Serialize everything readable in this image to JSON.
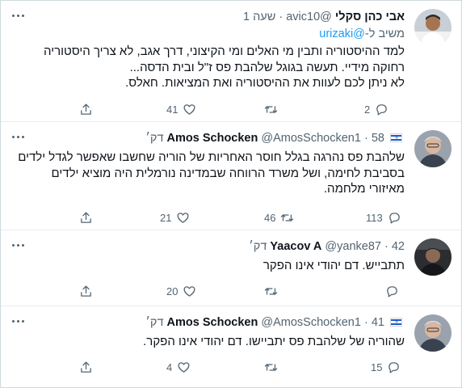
{
  "tweets": [
    {
      "name": "אבי כהן סקלי",
      "handle": "@avic10",
      "time": "שעה 1",
      "reply_prefix": "משיב ל-",
      "reply_user": "@urizaki",
      "text": "למד ההיסטוריה ותבין מי האלים ומי הקיצוני, דרך אגב, לא צריך היסטוריה רחוקה מידיי. תעשה בגוגל שלהבת פס ז\"ל ובית הדסה...\nלא ניתן לכם לעוות את ההיסטוריה ואת המציאות. חאלס.",
      "replies": "2",
      "retweets": "",
      "likes": "41",
      "avatar": "profile-photo-white-shirt"
    },
    {
      "name": "Amos Schocken",
      "handle": "@AmosSchocken1",
      "time": "58 דק׳",
      "text": "שלהבת פס נהרגה בגלל חוסר האחריות של הוריה שחשבו שאפשר לגדל ילדים בסביבת לחימה, ושל משרד הרווחה שבמדינה נורמלית היה מוציא ילדים מאיזורי מלחמה.",
      "replies": "113",
      "retweets": "46",
      "likes": "21",
      "avatar": "profile-photo-grey-hair"
    },
    {
      "name": "Yaacov A",
      "handle": "@yanke87",
      "time": "42 דק׳",
      "text": "תתבייש. דם יהודי אינו הפקר",
      "replies": "",
      "retweets": "",
      "likes": "20",
      "avatar": "profile-photo-dark"
    },
    {
      "name": "Amos Schocken",
      "handle": "@AmosSchocken1",
      "time": "41 דק׳",
      "text": "שהוריה של שלהבת פס יתביישו. דם יהודי אינו הפקר.",
      "replies": "15",
      "retweets": "",
      "likes": "4",
      "avatar": "profile-photo-grey-hair"
    }
  ],
  "colors": {
    "link": "#1d9bf0",
    "muted": "#536471",
    "text": "#0f1419"
  }
}
